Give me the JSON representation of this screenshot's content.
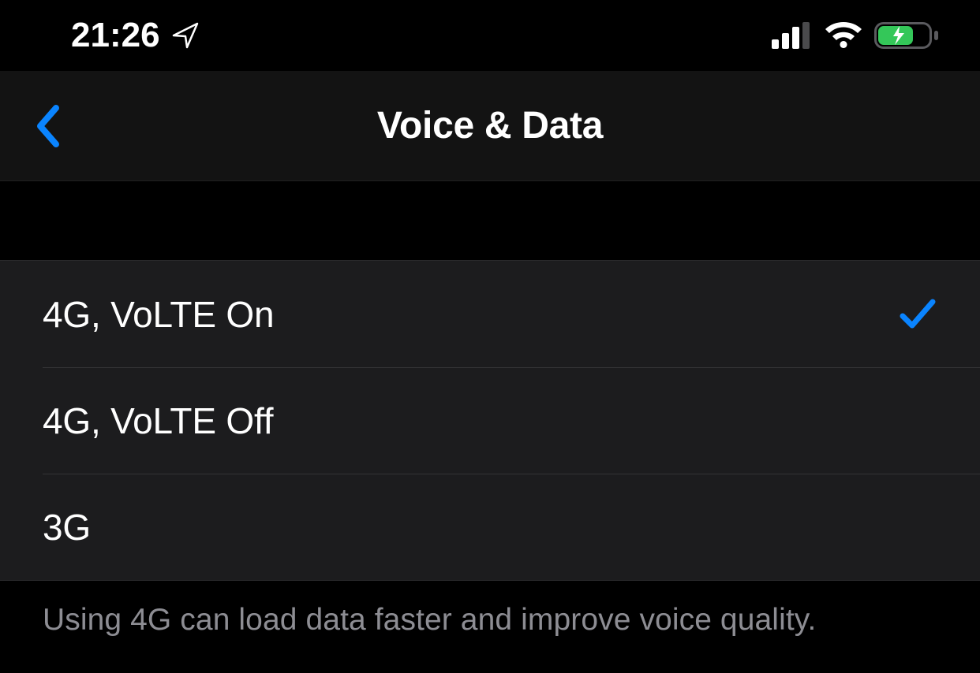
{
  "status": {
    "time": "21:26"
  },
  "header": {
    "title": "Voice & Data"
  },
  "options": [
    {
      "label": "4G, VoLTE On",
      "selected": true
    },
    {
      "label": "4G, VoLTE Off",
      "selected": false
    },
    {
      "label": "3G",
      "selected": false
    }
  ],
  "footer": {
    "text": "Using 4G can load data faster and improve voice quality."
  },
  "colors": {
    "accent": "#0a84ff",
    "battery_fill": "#34c759"
  }
}
